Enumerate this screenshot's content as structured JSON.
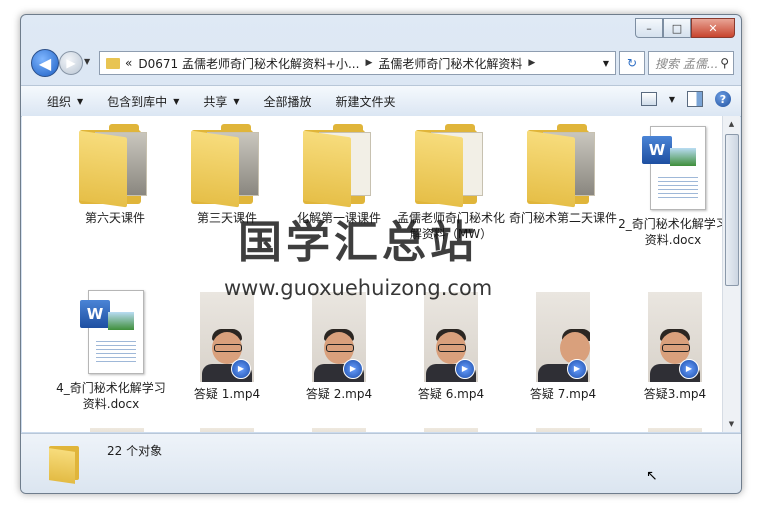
{
  "window": {
    "minimize_glyph": "–",
    "maximize_glyph": "□",
    "close_glyph": "✕"
  },
  "navigation": {
    "back_glyph": "◀",
    "forward_glyph": "▶",
    "address_prefix": "«",
    "breadcrumb": [
      "D0671 孟儒老师奇门秘术化解资料+小...",
      "孟儒老师奇门秘术化解资料"
    ],
    "separator_glyph": "▶",
    "search_placeholder": "搜索 孟儒...",
    "refresh_icon": "refresh-icon",
    "search_icon": "search-icon"
  },
  "toolbar": {
    "organize": "组织",
    "include_in_library": "包含到库中",
    "share": "共享",
    "play_all": "全部播放",
    "new_folder": "新建文件夹",
    "help_glyph": "?"
  },
  "items": [
    {
      "name": "第六天课件",
      "type": "folder"
    },
    {
      "name": "第三天课件",
      "type": "folder"
    },
    {
      "name": "化解第一课课件",
      "type": "folder"
    },
    {
      "name": "孟儒老师奇门秘术化解资料（MW）",
      "type": "folder"
    },
    {
      "name": "奇门秘术第二天课件",
      "type": "folder"
    },
    {
      "name": "2_奇门秘术化解学习资料.docx",
      "type": "docx"
    },
    {
      "name": "4_奇门秘术化解学习资料.docx",
      "type": "docx"
    },
    {
      "name": "答疑 1.mp4",
      "type": "video"
    },
    {
      "name": "答疑 2.mp4",
      "type": "video"
    },
    {
      "name": "答疑 6.mp4",
      "type": "video"
    },
    {
      "name": "答疑 7.mp4",
      "type": "video"
    },
    {
      "name": "答疑3.mp4",
      "type": "video"
    }
  ],
  "status": {
    "count_text": "22 个对象"
  },
  "watermark": {
    "title": "国学汇总站",
    "url": "www.guoxuehuizong.com"
  }
}
